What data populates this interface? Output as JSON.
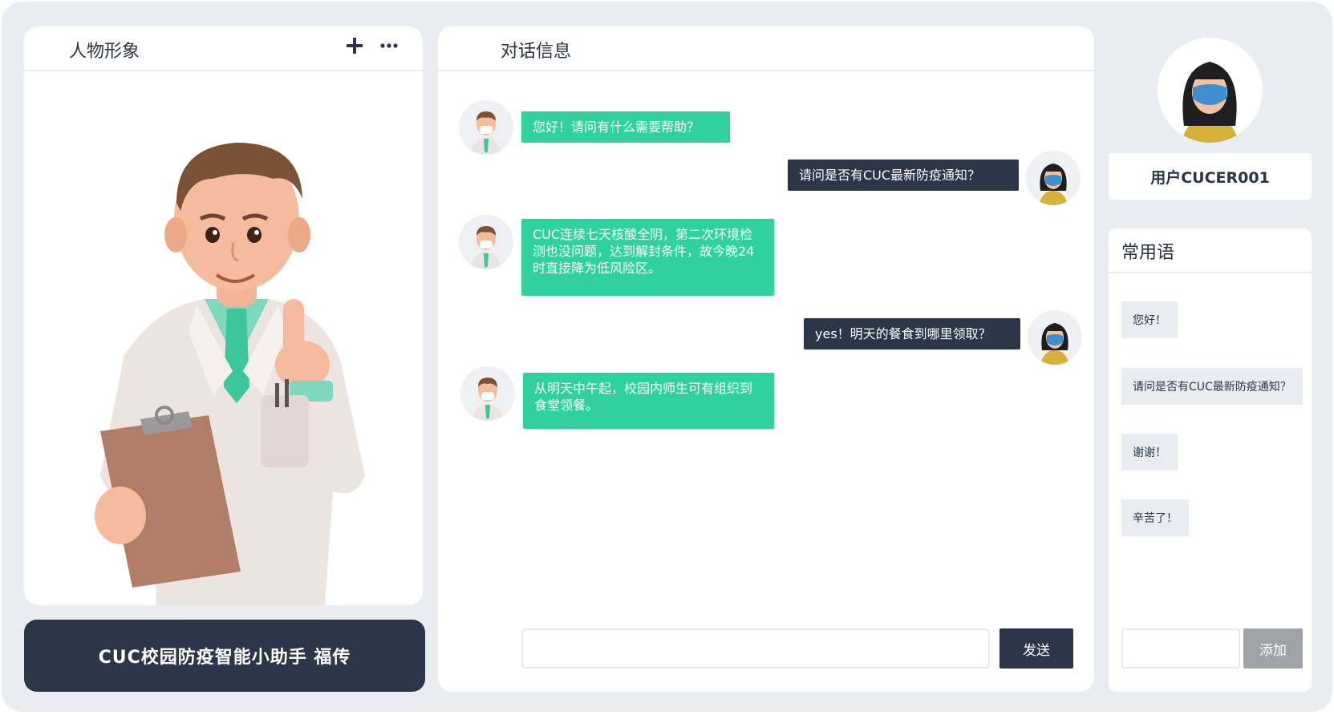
{
  "left_panel": {
    "title": "人物形象",
    "add_icon": "plus-icon",
    "more_icon": "more-horizontal-icon"
  },
  "assistant_name": "CUC校园防疫智能小助手  福传",
  "chat": {
    "title": "对话信息",
    "messages": [
      {
        "role": "bot",
        "text": "您好！请问有什么需要帮助？"
      },
      {
        "role": "user",
        "text": "请问是否有CUC最新防疫通知？"
      },
      {
        "role": "bot",
        "text": "CUC连续七天核酸全阴，第二次环境检测也没问题，达到解封条件，故今晚24时直接降为低风险区。"
      },
      {
        "role": "user",
        "text": "yes！明天的餐食到哪里领取？"
      },
      {
        "role": "bot",
        "text": "从明天中午起，校园内师生可有组织到食堂领餐。"
      }
    ],
    "input_placeholder": "",
    "send_label": "发送"
  },
  "user": {
    "name": "用户CUCER001"
  },
  "phrases": {
    "title": "常用语",
    "items": [
      "您好！",
      "请问是否有CUC最新防疫通知？",
      "谢谢！",
      "辛苦了！"
    ],
    "input_placeholder": "",
    "add_label": "添加"
  },
  "colors": {
    "bot_bubble": "#2fd19c",
    "user_bubble": "#2b3649",
    "background": "#e9edf2",
    "add_button": "#9fa3a8"
  }
}
